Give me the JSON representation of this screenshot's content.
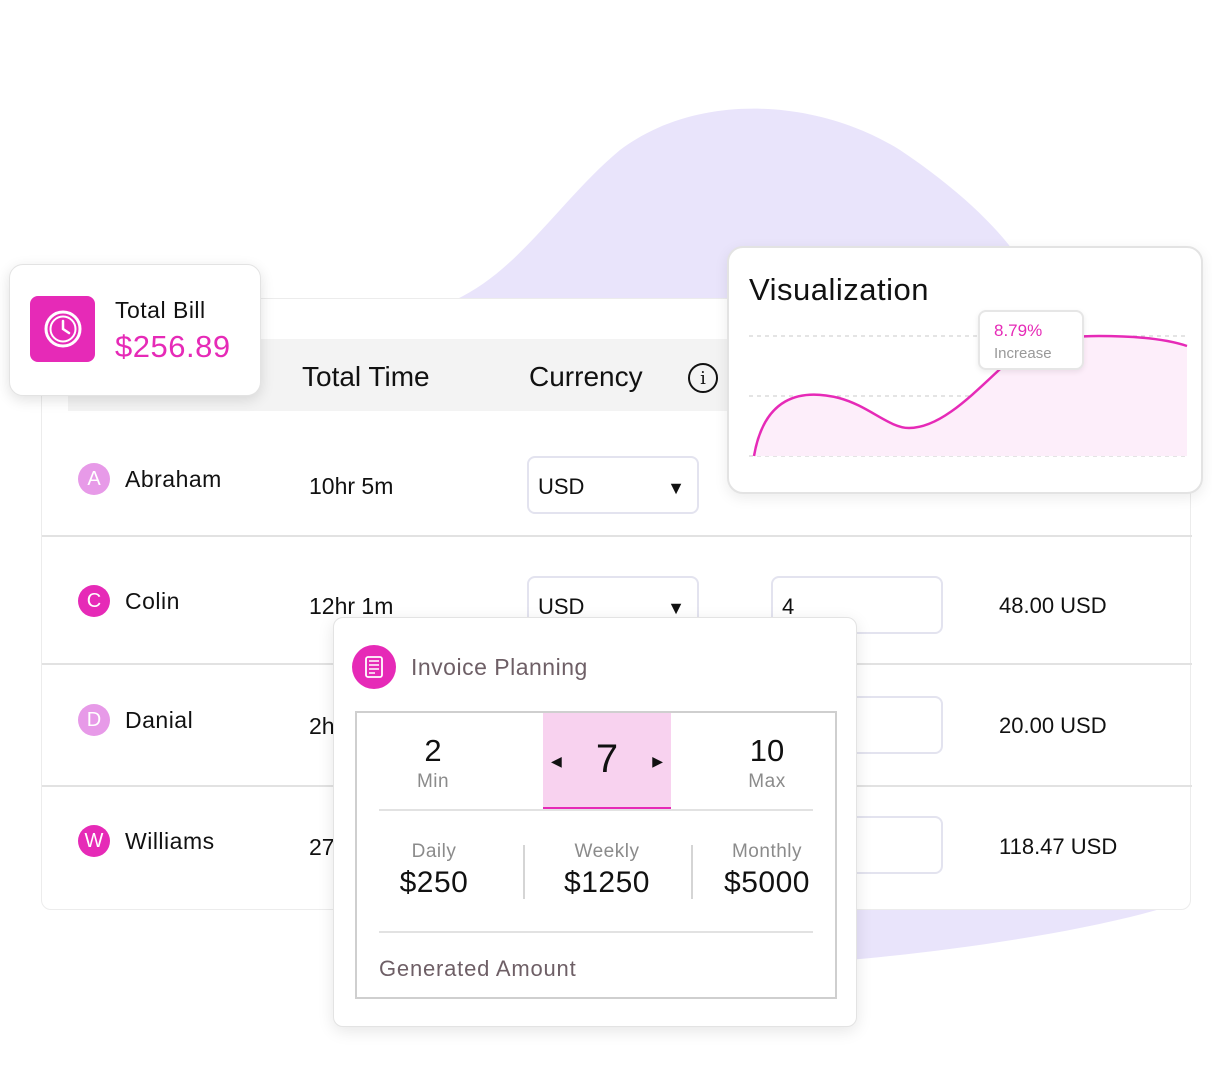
{
  "bill": {
    "title": "Total Bill",
    "value": "$256.89",
    "icon": "clock-icon"
  },
  "table": {
    "headers": {
      "time": "Total Time",
      "currency": "Currency"
    },
    "info_icon": "i",
    "rows": [
      {
        "initial": "A",
        "name": "Abraham",
        "time": "10hr 5m",
        "currency": "USD",
        "quantity": "",
        "amount": "",
        "avatar_color": "#e79ae8"
      },
      {
        "initial": "C",
        "name": "Colin",
        "time": "12hr 1m",
        "currency": "USD",
        "quantity": "4",
        "amount": "48.00 USD",
        "avatar_color": "#e62ab7"
      },
      {
        "initial": "D",
        "name": "Danial",
        "time": "2h",
        "currency": "",
        "quantity": "",
        "amount": "20.00 USD",
        "avatar_color": "#e79ae8"
      },
      {
        "initial": "W",
        "name": "Williams",
        "time": "27",
        "currency": "",
        "quantity": "",
        "amount": "118.47 USD",
        "avatar_color": "#e62ab7"
      }
    ]
  },
  "visualization": {
    "title": "Visualization",
    "tooltip": {
      "value": "8.79%",
      "label": "Increase"
    }
  },
  "invoice": {
    "title": "Invoice Planning",
    "icon": "invoice-icon",
    "stepper": {
      "min": "2",
      "min_label": "Min",
      "value": "7",
      "max": "10",
      "max_label": "Max"
    },
    "periods": [
      {
        "label": "Daily",
        "value": "$250"
      },
      {
        "label": "Weekly",
        "value": "$1250"
      },
      {
        "label": "Monthly",
        "value": "$5000"
      }
    ],
    "generated_label": "Generated Amount"
  },
  "colors": {
    "accent": "#e62ab7",
    "accent_light": "#f8d2ef",
    "blob": "#e9e4fb"
  }
}
